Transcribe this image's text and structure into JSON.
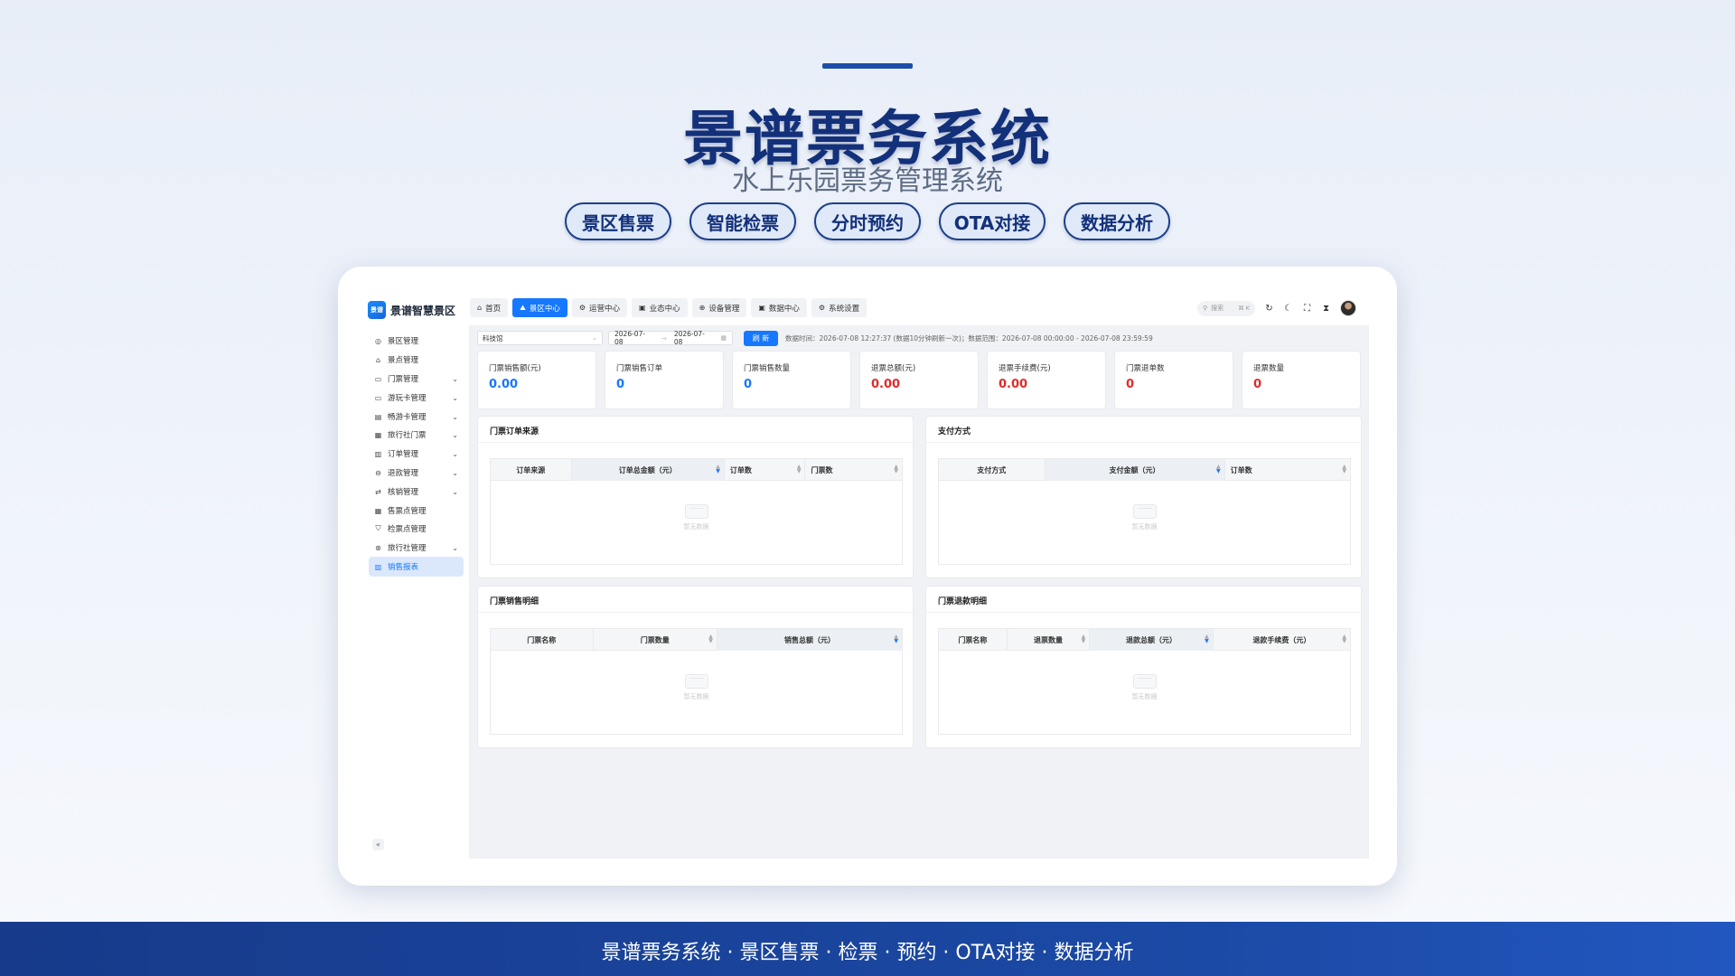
{
  "hero": {
    "title": "景谱票务系统",
    "subtitle": "水上乐园票务管理系统",
    "pills": [
      "景区售票",
      "智能检票",
      "分时预约",
      "OTA对接",
      "数据分析"
    ]
  },
  "app": {
    "logo_text": "景谱智慧景区",
    "logo_mark": "景谱",
    "nav": [
      {
        "label": "首页",
        "icon": "home-icon",
        "glyph": "⌂"
      },
      {
        "label": "景区中心",
        "icon": "landscape-icon",
        "glyph": "⛰"
      },
      {
        "label": "运营中心",
        "icon": "gear-icon",
        "glyph": "⚙"
      },
      {
        "label": "业态中心",
        "icon": "store-icon",
        "glyph": "▣"
      },
      {
        "label": "设备管理",
        "icon": "device-icon",
        "glyph": "⊕"
      },
      {
        "label": "数据中心",
        "icon": "chart-icon",
        "glyph": "▣"
      },
      {
        "label": "系统设置",
        "icon": "settings-icon",
        "glyph": "⚙"
      }
    ],
    "active_nav": 1,
    "search": {
      "placeholder": "搜索",
      "shortcut": "⌘ K"
    },
    "sidebar": [
      {
        "label": "景区管理",
        "icon": "scenic-icon",
        "glyph": "◎",
        "expandable": false
      },
      {
        "label": "景点管理",
        "icon": "attraction-icon",
        "glyph": "⌂",
        "expandable": false
      },
      {
        "label": "门票管理",
        "icon": "ticket-icon",
        "glyph": "▭",
        "expandable": true
      },
      {
        "label": "游玩卡管理",
        "icon": "card-icon",
        "glyph": "▭",
        "expandable": true
      },
      {
        "label": "畅游卡管理",
        "icon": "pass-icon",
        "glyph": "▤",
        "expandable": true
      },
      {
        "label": "旅行社门票",
        "icon": "agency-ticket-icon",
        "glyph": "▦",
        "expandable": true
      },
      {
        "label": "订单管理",
        "icon": "order-icon",
        "glyph": "▥",
        "expandable": true
      },
      {
        "label": "退款管理",
        "icon": "refund-icon",
        "glyph": "⊖",
        "expandable": true
      },
      {
        "label": "核销管理",
        "icon": "verify-icon",
        "glyph": "⇄",
        "expandable": true
      },
      {
        "label": "售票点管理",
        "icon": "sale-point-icon",
        "glyph": "▦",
        "expandable": false
      },
      {
        "label": "检票点管理",
        "icon": "check-point-icon",
        "glyph": "⛉",
        "expandable": false
      },
      {
        "label": "旅行社管理",
        "icon": "agency-icon",
        "glyph": "⊛",
        "expandable": true
      },
      {
        "label": "销售报表",
        "icon": "report-icon",
        "glyph": "▥",
        "expandable": false
      }
    ],
    "active_sidebar": 12,
    "collapse_glyph": "«",
    "filter": {
      "scenic_value": "科技馆",
      "date_start": "2026-07-08",
      "date_end": "2026-07-08",
      "refresh_label": "刷 新",
      "info": "数据时间：2026-07-08 12:27:37 (数据10分钟刷新一次)；数据范围：2026-07-08 00:00:00 - 2026-07-08 23:59:59"
    },
    "stats": [
      {
        "label": "门票销售额(元)",
        "value": "0.00",
        "color": "blue"
      },
      {
        "label": "门票销售订单",
        "value": "0",
        "color": "blue"
      },
      {
        "label": "门票销售数量",
        "value": "0",
        "color": "blue"
      },
      {
        "label": "退票总额(元)",
        "value": "0.00",
        "color": "red"
      },
      {
        "label": "退票手续费(元)",
        "value": "0.00",
        "color": "red"
      },
      {
        "label": "门票退单数",
        "value": "0",
        "color": "red"
      },
      {
        "label": "退票数量",
        "value": "0",
        "color": "red"
      }
    ],
    "panels": [
      {
        "title": "门票订单来源",
        "columns": [
          "订单来源",
          "订单总金额（元）",
          "订单数",
          "门票数"
        ],
        "sorted_col": 1,
        "empty_text": "暂无数据"
      },
      {
        "title": "支付方式",
        "columns": [
          "支付方式",
          "支付金额（元）",
          "订单数"
        ],
        "sorted_col": 1,
        "empty_text": "暂无数据"
      },
      {
        "title": "门票销售明细",
        "columns": [
          "门票名称",
          "门票数量",
          "销售总额（元）"
        ],
        "sorted_col": 2,
        "empty_text": "暂无数据"
      },
      {
        "title": "门票退款明细",
        "columns": [
          "门票名称",
          "退票数量",
          "退款总额（元）",
          "退款手续费（元）"
        ],
        "sorted_col": 2,
        "empty_text": "暂无数据"
      }
    ]
  },
  "footer": {
    "text": "景谱票务系统 · 景区售票 · 检票 · 预约 · OTA对接 · 数据分析"
  },
  "colors": {
    "brand": "#1677ff",
    "navy": "#13307a",
    "negative": "#e02b2b"
  }
}
